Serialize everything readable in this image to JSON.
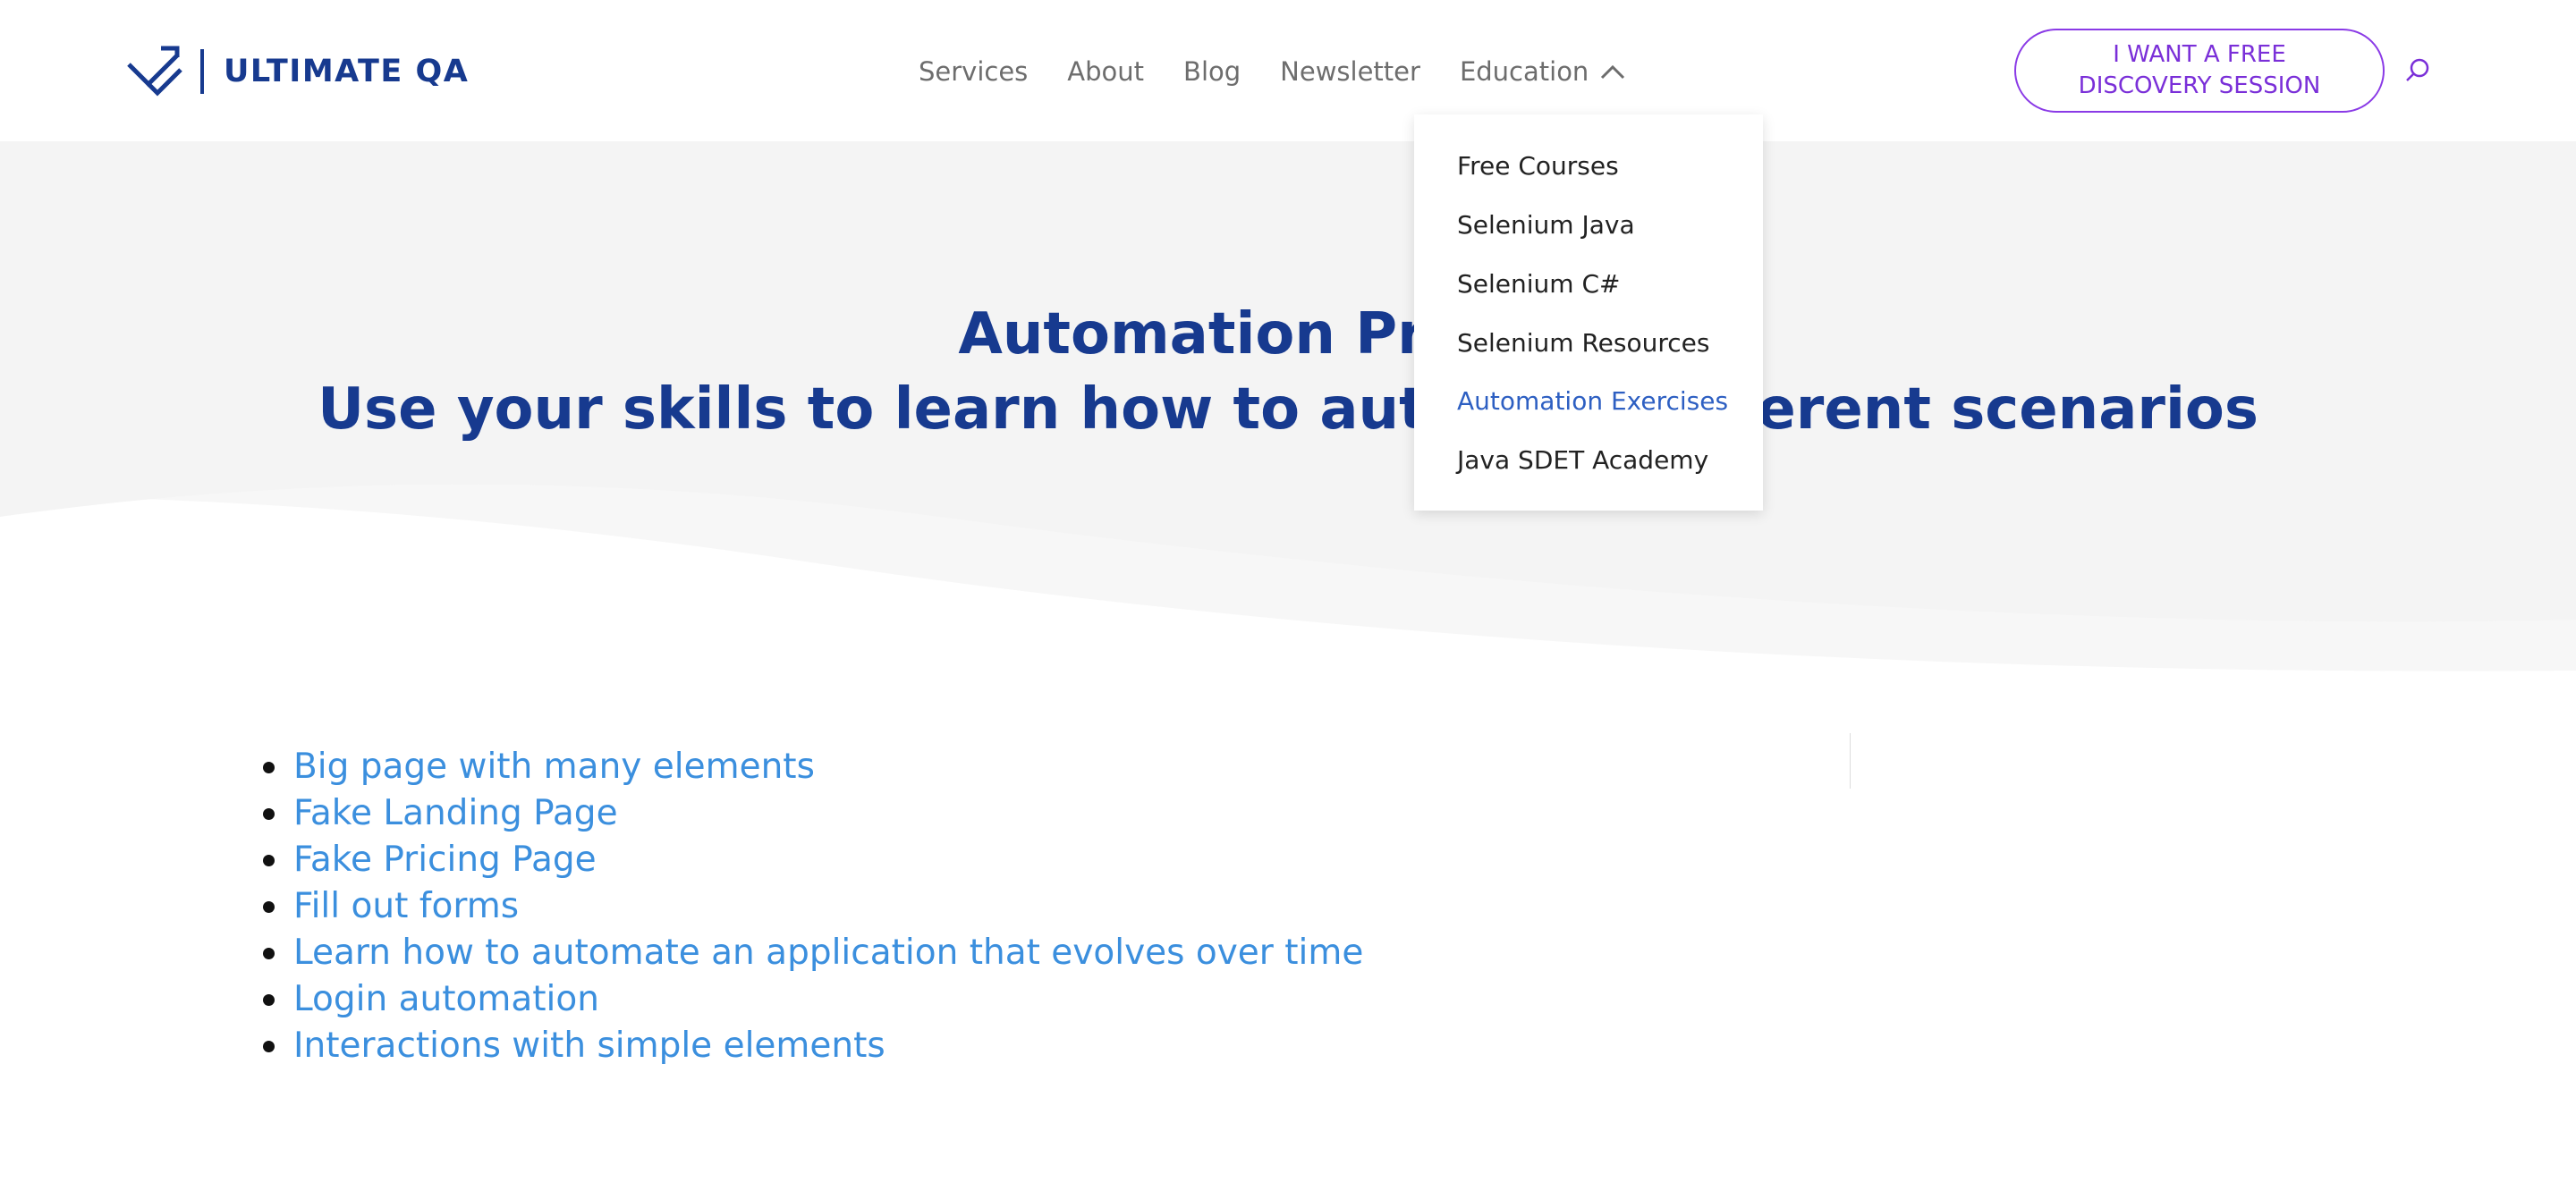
{
  "header": {
    "logo_text": "ULTIMATE QA",
    "nav": [
      {
        "label": "Services"
      },
      {
        "label": "About"
      },
      {
        "label": "Blog"
      },
      {
        "label": "Newsletter"
      },
      {
        "label": "Education"
      }
    ],
    "cta": {
      "label": "I WANT A FREE DISCOVERY SESSION"
    },
    "search_icon": "search-icon"
  },
  "dropdown": {
    "parent": "Education",
    "items": [
      {
        "label": "Free Courses"
      },
      {
        "label": "Selenium Java"
      },
      {
        "label": "Selenium C#"
      },
      {
        "label": "Selenium Resources"
      },
      {
        "label": "Automation Exercises",
        "active": true
      },
      {
        "label": "Java SDET Academy"
      }
    ]
  },
  "hero": {
    "title_line1": "Automation Practice",
    "title_line2": "Use your skills to learn how to automate different scenarios"
  },
  "links": [
    {
      "label": "Big page with many elements"
    },
    {
      "label": "Fake Landing Page"
    },
    {
      "label": "Fake Pricing Page"
    },
    {
      "label": "Fill out forms"
    },
    {
      "label": "Learn how to automate an application that evolves over time"
    },
    {
      "label": "Login automation"
    },
    {
      "label": "Interactions with simple elements"
    }
  ],
  "colors": {
    "brand": "#173a8f",
    "link": "#3b8fde",
    "cta": "#7a2fd8",
    "active_menu": "#2d5fc2",
    "hero_bg": "#f4f4f4"
  }
}
